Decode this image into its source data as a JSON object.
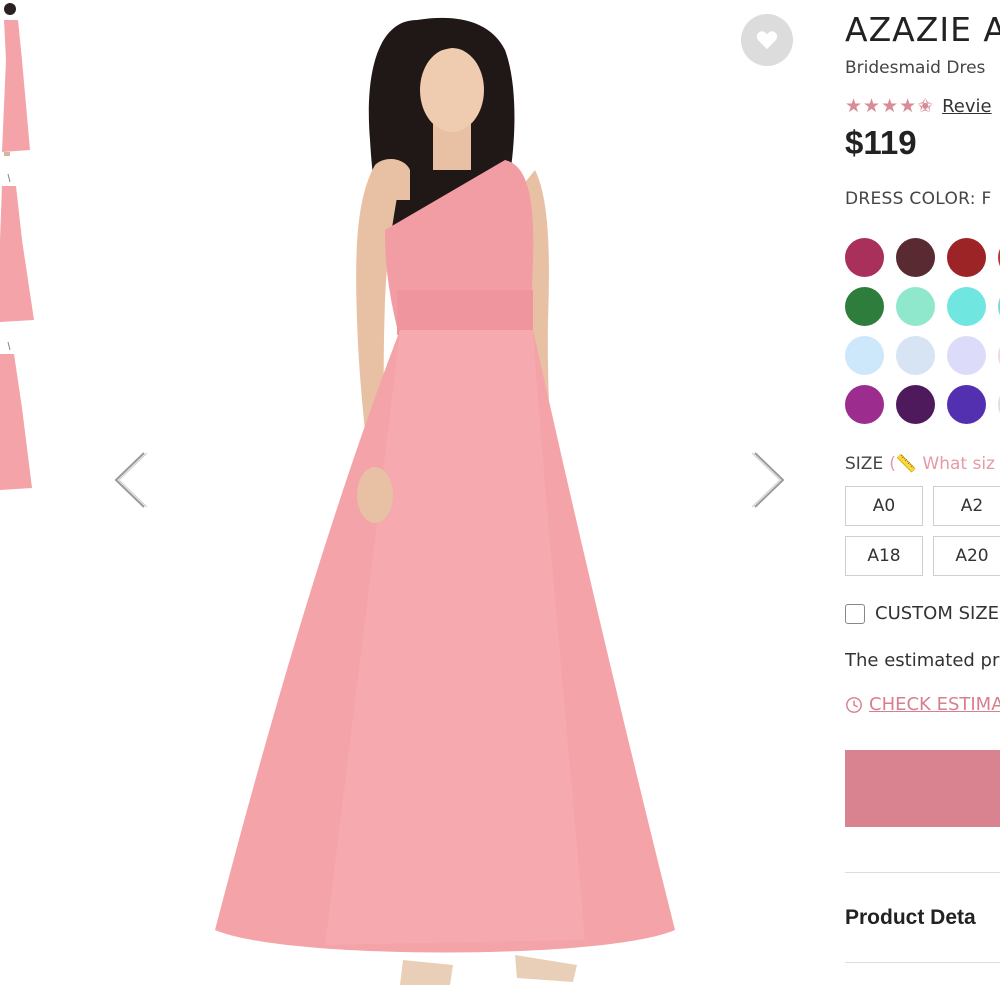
{
  "product": {
    "brand": "AZAZIE A",
    "subtitle": "Bridesmaid Dres",
    "rating_value": 4.5,
    "reviews_label": "Revie",
    "price": "$119"
  },
  "color": {
    "label": "DRESS COLOR: F",
    "swatches": [
      {
        "name": "swatch-1",
        "hex": "#a8305a"
      },
      {
        "name": "swatch-2",
        "hex": "#5a2a33"
      },
      {
        "name": "swatch-3",
        "hex": "#9c2426"
      },
      {
        "name": "swatch-4",
        "hex": "#b53a2c"
      },
      {
        "name": "swatch-5",
        "hex": "#2e7d3c"
      },
      {
        "name": "swatch-6",
        "hex": "#8fe8cc"
      },
      {
        "name": "swatch-7",
        "hex": "#6fe6e0"
      },
      {
        "name": "swatch-8",
        "hex": "#79d9d9"
      },
      {
        "name": "swatch-9",
        "hex": "#cde7fb"
      },
      {
        "name": "swatch-10",
        "hex": "#d6e4f3"
      },
      {
        "name": "swatch-11",
        "hex": "#dcdcfa"
      },
      {
        "name": "swatch-12",
        "hex": "#f0d6ea"
      },
      {
        "name": "swatch-13",
        "hex": "#9c2d8e"
      },
      {
        "name": "swatch-14",
        "hex": "#4f1a5c"
      },
      {
        "name": "swatch-15",
        "hex": "#5230b0"
      },
      {
        "name": "swatch-16",
        "hex": "#dedede"
      }
    ]
  },
  "size": {
    "label": "SIZE",
    "guide_label": "(📏 What siz",
    "options": [
      "A0",
      "A2",
      "A18",
      "A20"
    ]
  },
  "custom_size": {
    "label": "CUSTOM SIZE"
  },
  "estimate": {
    "text": "The estimated pr",
    "link_label": "CHECK ESTIMA"
  },
  "details": {
    "label": "Product Deta"
  },
  "colors": {
    "accent": "#d98290",
    "star": "#d98b97",
    "link": "#d77f8e",
    "dress": "#f4a3a8"
  }
}
